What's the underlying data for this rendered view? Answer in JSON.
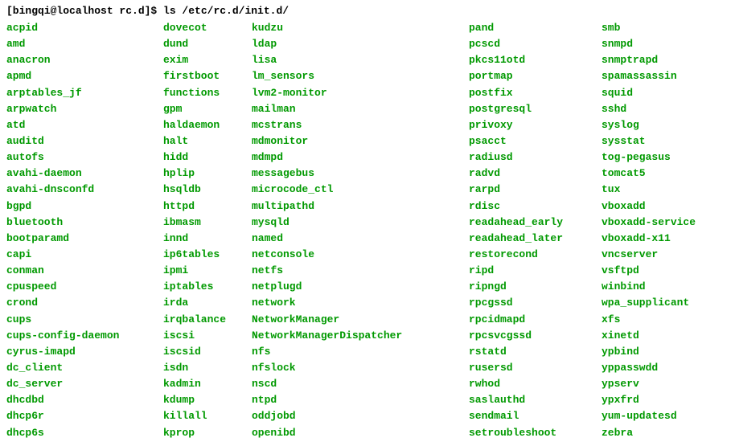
{
  "prompt": "[bingqi@localhost rc.d]$ ls /etc/rc.d/init.d/",
  "rows": [
    {
      "c1": "acpid",
      "c2": "dovecot",
      "c3": "kudzu",
      "c4": "pand",
      "c5": "smb"
    },
    {
      "c1": "amd",
      "c2": "dund",
      "c3": "ldap",
      "c4": "pcscd",
      "c5": "snmpd"
    },
    {
      "c1": "anacron",
      "c2": "exim",
      "c3": "lisa",
      "c4": "pkcs11otd",
      "c5": "snmptrapd"
    },
    {
      "c1": "apmd",
      "c2": "firstboot",
      "c3": "lm_sensors",
      "c4": "portmap",
      "c5": "spamassassin"
    },
    {
      "c1": "arptables_jf",
      "c2": "functions",
      "c3": "lvm2-monitor",
      "c4": "postfix",
      "c5": "squid"
    },
    {
      "c1": "arpwatch",
      "c2": "gpm",
      "c3": "mailman",
      "c4": "postgresql",
      "c5": "sshd"
    },
    {
      "c1": "atd",
      "c2": "haldaemon",
      "c3": "mcstrans",
      "c4": "privoxy",
      "c5": "syslog"
    },
    {
      "c1": "auditd",
      "c2": "halt",
      "c3": "mdmonitor",
      "c4": "psacct",
      "c5": "sysstat"
    },
    {
      "c1": "autofs",
      "c2": "hidd",
      "c3": "mdmpd",
      "c4": "radiusd",
      "c5": "tog-pegasus"
    },
    {
      "c1": "avahi-daemon",
      "c2": "hplip",
      "c3": "messagebus",
      "c4": "radvd",
      "c5": "tomcat5"
    },
    {
      "c1": "avahi-dnsconfd",
      "c2": "hsqldb",
      "c3": "microcode_ctl",
      "c4": "rarpd",
      "c5": "tux"
    },
    {
      "c1": "bgpd",
      "c2": "httpd",
      "c3": "multipathd",
      "c4": "rdisc",
      "c5": "vboxadd"
    },
    {
      "c1": "bluetooth",
      "c2": "ibmasm",
      "c3": "mysqld",
      "c4": "readahead_early",
      "c5": "vboxadd-service"
    },
    {
      "c1": "bootparamd",
      "c2": "innd",
      "c3": "named",
      "c4": "readahead_later",
      "c5": "vboxadd-x11"
    },
    {
      "c1": "capi",
      "c2": "ip6tables",
      "c3": "netconsole",
      "c4": "restorecond",
      "c5": "vncserver"
    },
    {
      "c1": "conman",
      "c2": "ipmi",
      "c3": "netfs",
      "c4": "ripd",
      "c5": "vsftpd"
    },
    {
      "c1": "cpuspeed",
      "c2": "iptables",
      "c3": "netplugd",
      "c4": "ripngd",
      "c5": "winbind"
    },
    {
      "c1": "crond",
      "c2": "irda",
      "c3": "network",
      "c4": "rpcgssd",
      "c5": "wpa_supplicant"
    },
    {
      "c1": "cups",
      "c2": "irqbalance",
      "c3": "NetworkManager",
      "c4": "rpcidmapd",
      "c5": "xfs"
    },
    {
      "c1": "cups-config-daemon",
      "c2": "iscsi",
      "c3": "NetworkManagerDispatcher",
      "c4": "rpcsvcgssd",
      "c5": "xinetd"
    },
    {
      "c1": "cyrus-imapd",
      "c2": "iscsid",
      "c3": "nfs",
      "c4": "rstatd",
      "c5": "ypbind"
    },
    {
      "c1": "dc_client",
      "c2": "isdn",
      "c3": "nfslock",
      "c4": "rusersd",
      "c5": "yppasswdd"
    },
    {
      "c1": "dc_server",
      "c2": "kadmin",
      "c3": "nscd",
      "c4": "rwhod",
      "c5": "ypserv"
    },
    {
      "c1": "dhcdbd",
      "c2": "kdump",
      "c3": "ntpd",
      "c4": "saslauthd",
      "c5": "ypxfrd"
    },
    {
      "c1": "dhcp6r",
      "c2": "killall",
      "c3": "oddjobd",
      "c4": "sendmail",
      "c5": "yum-updatesd"
    },
    {
      "c1": "dhcp6s",
      "c2": "kprop",
      "c3": "openibd",
      "c4": "setroubleshoot",
      "c5": "zebra"
    }
  ]
}
